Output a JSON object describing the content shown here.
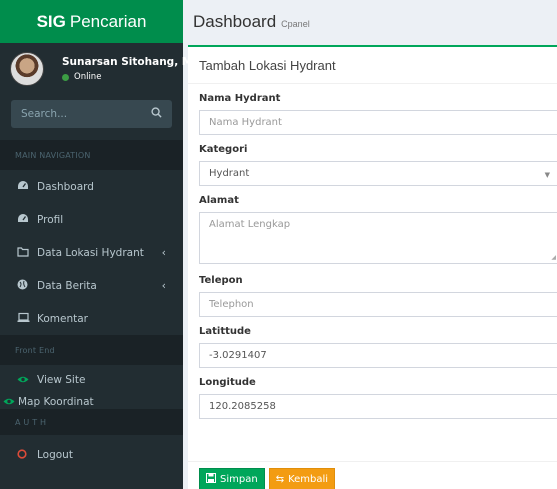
{
  "sidebar": {
    "logo_bold": "SIG",
    "logo_text": "Pencarian",
    "user_name": "Sunarsan Sitohang, M.TI.",
    "user_status": "Online",
    "search_placeholder": "Search...",
    "main_nav_header": "MAIN NAVIGATION",
    "items": [
      {
        "label": "Dashboard",
        "icon": "dashboard-icon"
      },
      {
        "label": "Profil",
        "icon": "dashboard-icon"
      },
      {
        "label": "Data Lokasi Hydrant",
        "icon": "folder-icon"
      },
      {
        "label": "Data Berita",
        "icon": "globe-icon"
      },
      {
        "label": "Komentar",
        "icon": "laptop-icon"
      }
    ],
    "frontend_header": "Front End",
    "frontend_items": [
      {
        "label": "View Site",
        "icon": "eye-icon"
      },
      {
        "label": "Map Koordinat",
        "icon": "eye-icon"
      }
    ],
    "auth_header": "A U T H",
    "logout_label": "Logout"
  },
  "header": {
    "title": "Dashboard",
    "subtitle": "Cpanel"
  },
  "form": {
    "box_title": "Tambah Lokasi Hydrant",
    "nama_label": "Nama Hydrant",
    "nama_placeholder": "Nama Hydrant",
    "kategori_label": "Kategori",
    "kategori_value": "Hydrant",
    "alamat_label": "Alamat",
    "alamat_placeholder": "Alamat Lengkap",
    "telepon_label": "Telepon",
    "telepon_placeholder": "Telephon",
    "latitude_label": "Latittude",
    "latitude_value": "-3.0291407",
    "longitude_label": "Longitude",
    "longitude_value": "120.2085258",
    "save_label": "Simpan",
    "back_label": "Kembali"
  },
  "colors": {
    "sidebar_bg": "#222d32",
    "logo_bg": "#008d4c",
    "success": "#00a65a",
    "warning": "#f39c12",
    "danger": "#dd4b39"
  }
}
